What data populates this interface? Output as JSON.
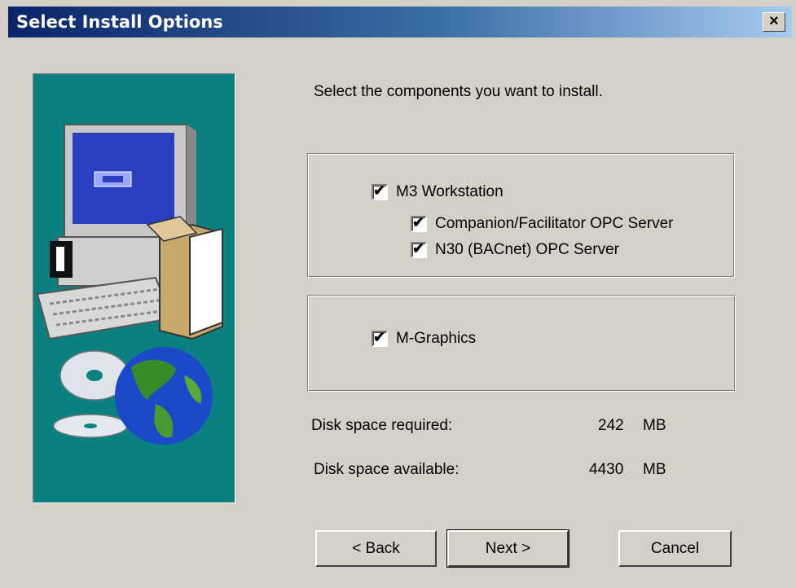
{
  "window": {
    "title": "Select Install Options",
    "close_label": "×"
  },
  "prompt": "Select the components you want to install.",
  "components": {
    "m3_workstation": {
      "label": "M3 Workstation",
      "checked": true
    },
    "companion_opc": {
      "label": "Companion/Facilitator OPC Server",
      "checked": true
    },
    "n30_opc": {
      "label": "N30 (BACnet) OPC Server",
      "checked": true
    },
    "m_graphics": {
      "label": "M-Graphics",
      "checked": true
    }
  },
  "disk": {
    "required_label": "Disk space required:",
    "required_value": "242",
    "required_unit": "MB",
    "available_label": "Disk space available:",
    "available_value": "4430",
    "available_unit": "MB"
  },
  "buttons": {
    "back": "< Back",
    "next": "Next >",
    "cancel": "Cancel"
  },
  "check_mark": "✔",
  "colors": {
    "titlebar_start": "#0a246a",
    "titlebar_end": "#a6caf0",
    "panel_bg": "#0b8080",
    "dialog_bg": "#d4d0c8"
  },
  "icons": [
    "computer-illustration",
    "cd-disc-icon",
    "globe-icon",
    "software-box-icon"
  ]
}
